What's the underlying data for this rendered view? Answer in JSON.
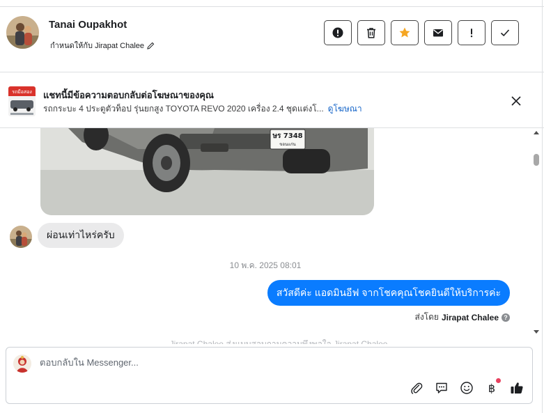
{
  "header": {
    "contact_name": "Tanai Oupakhot",
    "assign_text": "กำหนดให้กับ Jirapat Chalee",
    "buttons": [
      {
        "icon": "alert-circle-icon"
      },
      {
        "icon": "trash-icon"
      },
      {
        "icon": "star-icon"
      },
      {
        "icon": "envelope-icon"
      },
      {
        "icon": "exclamation-icon"
      },
      {
        "icon": "check-icon"
      }
    ]
  },
  "ad_banner": {
    "title": "แชทนี้มีข้อความตอบกลับต่อโฆษณาของคุณ",
    "description": "รถกระบะ 4 ประตูตัวท็อป รุ่นยกสูง TOYOTA REVO 2020 เครื่อง 2.4 ชุดแต่งโ...",
    "link": "ดูโฆษณา",
    "thumb_text": "รถมือสอง"
  },
  "messages": {
    "photo_plate_line1": "ษร 7348",
    "photo_plate_line2": "ขอนแก่น",
    "incoming_text": "ผ่อนเท่าไหร่ครับ",
    "timestamp": "10 พ.ค. 2025 08:01",
    "outgoing_text": "สวัสดีค่ะ แอดมินอีฟ จากโชคคุณโชคยินดีให้บริการค่ะ",
    "sent_by_label": "ส่งโดย",
    "sent_by_name": "Jirapat Chalee",
    "help_glyph": "?",
    "cutoff_text": "Jirapat Chalee ส่งแบบสอบถามความพึงพอใจ Jirapat Chalee"
  },
  "composer": {
    "placeholder": "ตอบกลับใน Messenger...",
    "baht_symbol": "฿"
  },
  "colors": {
    "accent_blue": "#0a7cff",
    "link_blue": "#1464c8",
    "star_orange": "#f5a623",
    "notify_dot": "#e8415f"
  }
}
